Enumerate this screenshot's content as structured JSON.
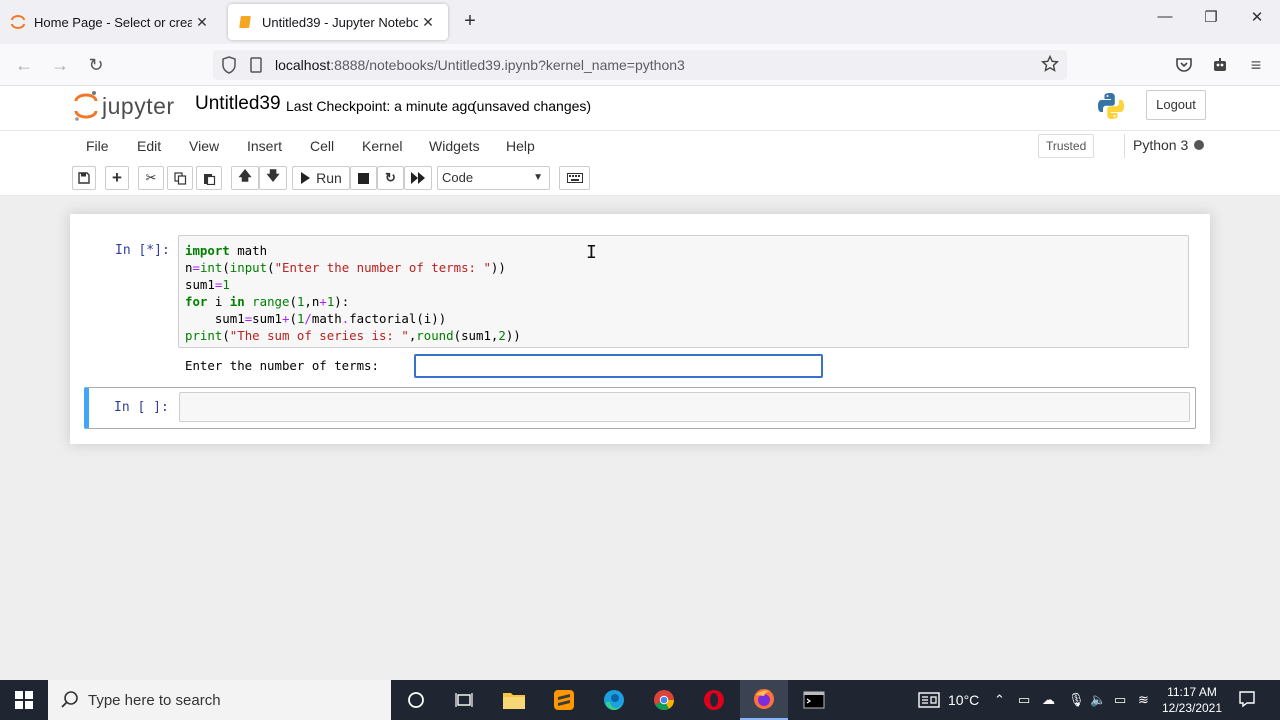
{
  "browser": {
    "tabs": [
      {
        "title": "Home Page - Select or create a",
        "active": false
      },
      {
        "title": "Untitled39 - Jupyter Notebook",
        "active": true
      }
    ],
    "url_host": "localhost",
    "url_rest": ":8888/notebooks/Untitled39.ipynb?kernel_name=python3"
  },
  "jupyter": {
    "logo_text": "jupyter",
    "notebook_title": "Untitled39",
    "checkpoint": "Last Checkpoint: a minute ago",
    "unsaved": "(unsaved changes)",
    "logout_label": "Logout",
    "menu": [
      "File",
      "Edit",
      "View",
      "Insert",
      "Cell",
      "Kernel",
      "Widgets",
      "Help"
    ],
    "trusted_label": "Trusted",
    "kernel_name": "Python 3",
    "run_label": "Run",
    "cell_type": "Code"
  },
  "cells": [
    {
      "prompt": "In [*]:",
      "code": [
        "import math",
        "n=int(input(\"Enter the number of terms: \"))",
        "sum1=1",
        "for i in range(1,n+1):",
        "    sum1=sum1+(1/math.factorial(i))",
        "print(\"The sum of series is: \",round(sum1,2))"
      ],
      "stdin_prompt": "Enter the number of terms:",
      "stdin_value": ""
    },
    {
      "prompt": "In [ ]:",
      "code": []
    }
  ],
  "taskbar": {
    "search_placeholder": "Type here to search",
    "weather": "10°C",
    "time": "11:17 AM",
    "date": "12/23/2021"
  },
  "colors": {
    "jupyter_orange": "#f37726",
    "prompt_blue": "#303f9f",
    "selected_cell_bar": "#42a5f5",
    "taskbar_bg": "#1f2631"
  }
}
